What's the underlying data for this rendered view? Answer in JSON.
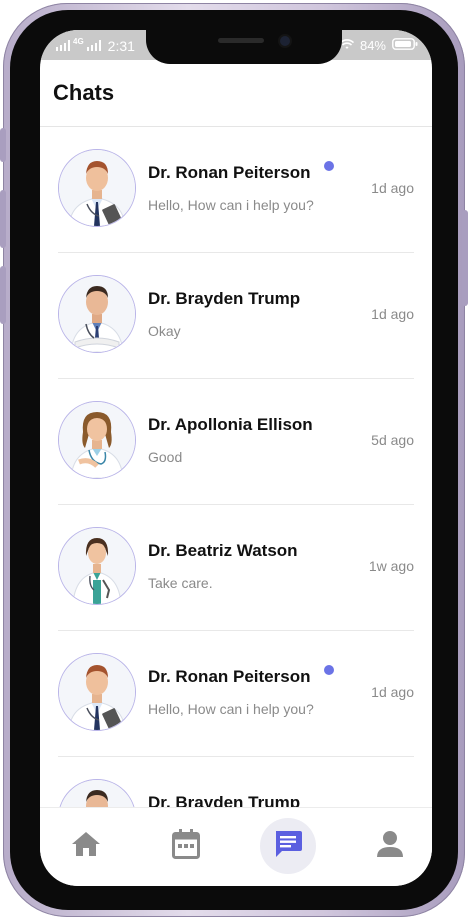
{
  "status_bar": {
    "time": "2:31",
    "network": "4G",
    "battery": "84%"
  },
  "header": {
    "title": "Chats"
  },
  "chats": [
    {
      "name": "Dr. Ronan Peiterson",
      "message": "Hello, How can i help you?",
      "time": "1d ago",
      "unread": true
    },
    {
      "name": "Dr. Brayden Trump",
      "message": "Okay",
      "time": "1d ago",
      "unread": false
    },
    {
      "name": "Dr. Apollonia Ellison",
      "message": "Good",
      "time": "5d ago",
      "unread": false
    },
    {
      "name": "Dr. Beatriz Watson",
      "message": "Take care.",
      "time": "1w ago",
      "unread": false
    },
    {
      "name": "Dr. Ronan Peiterson",
      "message": "Hello, How can i help you?",
      "time": "1d ago",
      "unread": true
    },
    {
      "name": "Dr. Brayden Trump",
      "message": "",
      "time": "",
      "unread": false
    }
  ],
  "bottom_nav": {
    "items": [
      {
        "icon": "home-icon",
        "active": false
      },
      {
        "icon": "calendar-icon",
        "active": false
      },
      {
        "icon": "chat-icon",
        "active": true
      },
      {
        "icon": "profile-icon",
        "active": false
      }
    ]
  },
  "colors": {
    "accent": "#5b5fe0",
    "unread_dot": "#6b73e6",
    "nav_inactive": "#8a8a8a",
    "frame": "#cfc5dc"
  }
}
